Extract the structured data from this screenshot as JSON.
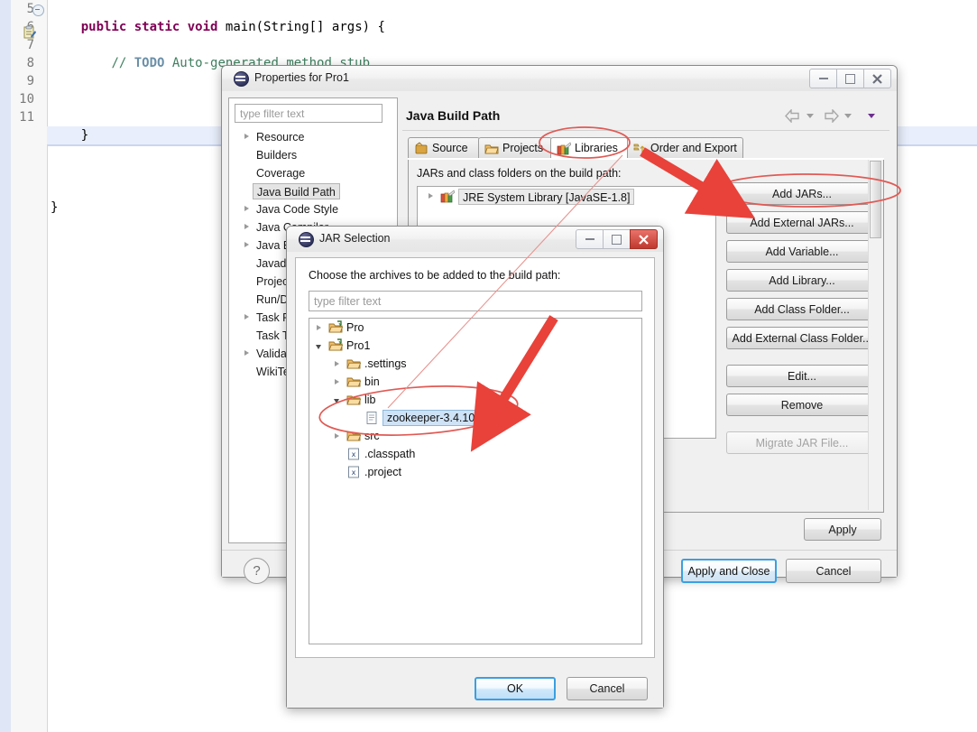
{
  "editor": {
    "line_numbers": [
      "5",
      "6",
      "7",
      "8",
      "9",
      "10",
      "11"
    ],
    "code_lines": [
      "    public static void main(String[] args) {",
      "        // TODO Auto-generated method stub",
      "",
      "    }",
      "",
      "}",
      ""
    ],
    "tokens": {
      "kw_public": "public",
      "kw_static": "static",
      "kw_void": "void",
      "main_sig": "main(String[] args) {",
      "comment_slashes": "// ",
      "comment_todo": "TODO",
      "comment_rest": " Auto-generated method stub",
      "brace_inner": "    }",
      "brace_outer": "}"
    },
    "colors": {
      "keyword": "#7f0055",
      "comment": "#3f7f5f",
      "todo": "#6a8fa8",
      "highlight_line": "#e8eefb"
    }
  },
  "properties_dialog": {
    "title": "Properties for Pro1",
    "filter_placeholder": "type filter text",
    "tree_items": [
      {
        "label": "Resource",
        "expandable": true,
        "selected": false
      },
      {
        "label": "Builders",
        "expandable": false,
        "selected": false
      },
      {
        "label": "Coverage",
        "expandable": false,
        "selected": false
      },
      {
        "label": "Java Build Path",
        "expandable": false,
        "selected": true
      },
      {
        "label": "Java Code Style",
        "expandable": true,
        "selected": false
      },
      {
        "label": "Java Compiler",
        "expandable": true,
        "selected": false
      },
      {
        "label": "Java Editor",
        "expandable": true,
        "selected": false
      },
      {
        "label": "Javadoc Location",
        "expandable": false,
        "selected": false
      },
      {
        "label": "Project References",
        "expandable": false,
        "selected": false
      },
      {
        "label": "Run/Debug Settings",
        "expandable": false,
        "selected": false
      },
      {
        "label": "Task Repository",
        "expandable": true,
        "selected": false
      },
      {
        "label": "Task Tags",
        "expandable": false,
        "selected": false
      },
      {
        "label": "Validation",
        "expandable": true,
        "selected": false
      },
      {
        "label": "WikiText",
        "expandable": false,
        "selected": false
      }
    ],
    "page_heading": "Java Build Path",
    "tabs": [
      {
        "label": "Source",
        "icon": "source-folder-icon",
        "active": false
      },
      {
        "label": "Projects",
        "icon": "projects-folder-icon",
        "active": false
      },
      {
        "label": "Libraries",
        "icon": "libraries-books-icon",
        "active": true
      },
      {
        "label": "Order and Export",
        "icon": "order-export-icon",
        "active": false
      }
    ],
    "pane_label": "JARs and class folders on the build path:",
    "library_entries": [
      {
        "label": "JRE System Library [JavaSE-1.8]",
        "icon": "libraries-books-icon",
        "expandable": true
      }
    ],
    "side_buttons": [
      {
        "label": "Add JARs...",
        "enabled": true,
        "highlighted": true
      },
      {
        "label": "Add External JARs...",
        "enabled": true,
        "highlighted": false
      },
      {
        "label": "Add Variable...",
        "enabled": true,
        "highlighted": false
      },
      {
        "label": "Add Library...",
        "enabled": true,
        "highlighted": false
      },
      {
        "label": "Add Class Folder...",
        "enabled": true,
        "highlighted": false
      },
      {
        "label": "Add External Class Folder...",
        "enabled": true,
        "highlighted": false
      },
      {
        "label": "Edit...",
        "enabled": true,
        "highlighted": false
      },
      {
        "label": "Remove",
        "enabled": true,
        "highlighted": false
      },
      {
        "label": "Migrate JAR File...",
        "enabled": false,
        "highlighted": false
      }
    ],
    "apply_label": "Apply",
    "apply_and_close_label": "Apply and Close",
    "cancel_label": "Cancel",
    "help_glyph": "?",
    "window_controls": {
      "minimize": "minimize-icon",
      "maximize": "maximize-icon",
      "close": "close-icon"
    }
  },
  "jar_selection_dialog": {
    "title": "JAR Selection",
    "prompt": "Choose the archives to be added to the build path:",
    "filter_placeholder": "type filter text",
    "tree": [
      {
        "label": "Pro",
        "icon": "project-folder-icon",
        "indent": 0,
        "state": "collapsed",
        "selected": false
      },
      {
        "label": "Pro1",
        "icon": "project-folder-icon",
        "indent": 0,
        "state": "expanded",
        "selected": false
      },
      {
        "label": ".settings",
        "icon": "folder-icon",
        "indent": 1,
        "state": "collapsed",
        "selected": false
      },
      {
        "label": "bin",
        "icon": "folder-icon",
        "indent": 1,
        "state": "collapsed",
        "selected": false
      },
      {
        "label": "lib",
        "icon": "folder-icon",
        "indent": 1,
        "state": "expanded",
        "selected": false
      },
      {
        "label": "zookeeper-3.4.10.jar",
        "icon": "jar-file-icon",
        "indent": 2,
        "state": "leaf",
        "selected": true
      },
      {
        "label": "src",
        "icon": "folder-icon",
        "indent": 1,
        "state": "collapsed",
        "selected": false
      },
      {
        "label": ".classpath",
        "icon": "xml-file-icon",
        "indent": 1,
        "state": "leaf",
        "selected": false
      },
      {
        "label": ".project",
        "icon": "xml-file-icon",
        "indent": 1,
        "state": "leaf",
        "selected": false
      }
    ],
    "ok_label": "OK",
    "cancel_label": "Cancel",
    "window_controls": {
      "minimize": "minimize-icon",
      "maximize": "maximize-icon",
      "close": "close-icon"
    }
  },
  "annotations": {
    "accent_color": "#e8423a",
    "ellipse_color": "#e05a55",
    "items": [
      {
        "type": "ellipse",
        "target": "Libraries tab"
      },
      {
        "type": "ellipse",
        "target": "Add JARs... button"
      },
      {
        "type": "ellipse",
        "target": "zookeeper-3.4.10.jar"
      },
      {
        "type": "arrow",
        "from": "Libraries tab",
        "to": "Add JARs... button"
      },
      {
        "type": "arrow",
        "from": "Add JARs... button",
        "to": "zookeeper-3.4.10.jar"
      }
    ]
  }
}
